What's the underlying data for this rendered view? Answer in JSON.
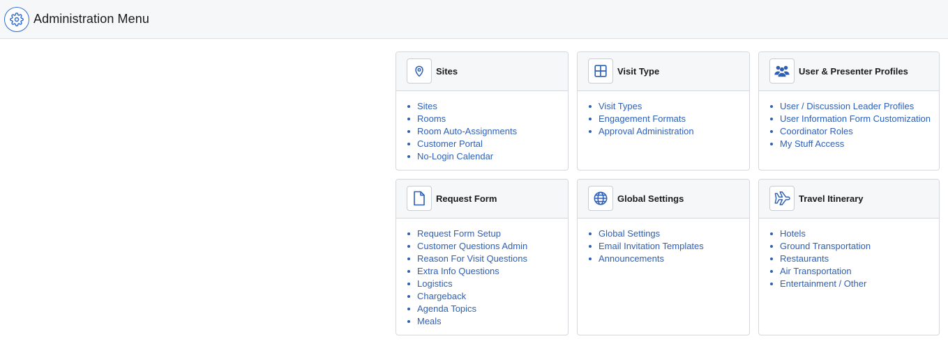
{
  "header": {
    "title": "Administration Menu",
    "icon": "gear-icon"
  },
  "colors": {
    "accent": "#2c5fb8",
    "header_bg": "#f6f7f8",
    "border": "#d4d7db"
  },
  "cards": [
    {
      "title": "Sites",
      "icon": "map-pin-icon",
      "items": [
        "Sites",
        "Rooms",
        "Room Auto-Assignments",
        "Customer Portal",
        "No-Login Calendar"
      ]
    },
    {
      "title": "Visit Type",
      "icon": "grid-icon",
      "items": [
        "Visit Types",
        "Engagement Formats",
        "Approval Administration"
      ]
    },
    {
      "title": "User & Presenter Profiles",
      "icon": "users-icon",
      "items": [
        "User / Discussion Leader Profiles",
        "User Information Form Customization",
        "Coordinator Roles",
        "My Stuff Access"
      ]
    },
    {
      "title": "Request Form",
      "icon": "document-icon",
      "items": [
        "Request Form Setup",
        "Customer Questions Admin",
        "Reason For Visit Questions",
        "Extra Info Questions",
        "Logistics",
        "Chargeback",
        "Agenda Topics",
        "Meals"
      ]
    },
    {
      "title": "Global Settings",
      "icon": "globe-icon",
      "items": [
        "Global Settings",
        "Email Invitation Templates",
        "Announcements"
      ]
    },
    {
      "title": "Travel Itinerary",
      "icon": "airplane-icon",
      "items": [
        "Hotels",
        "Ground Transportation",
        "Restaurants",
        "Air Transportation",
        "Entertainment / Other"
      ]
    }
  ]
}
